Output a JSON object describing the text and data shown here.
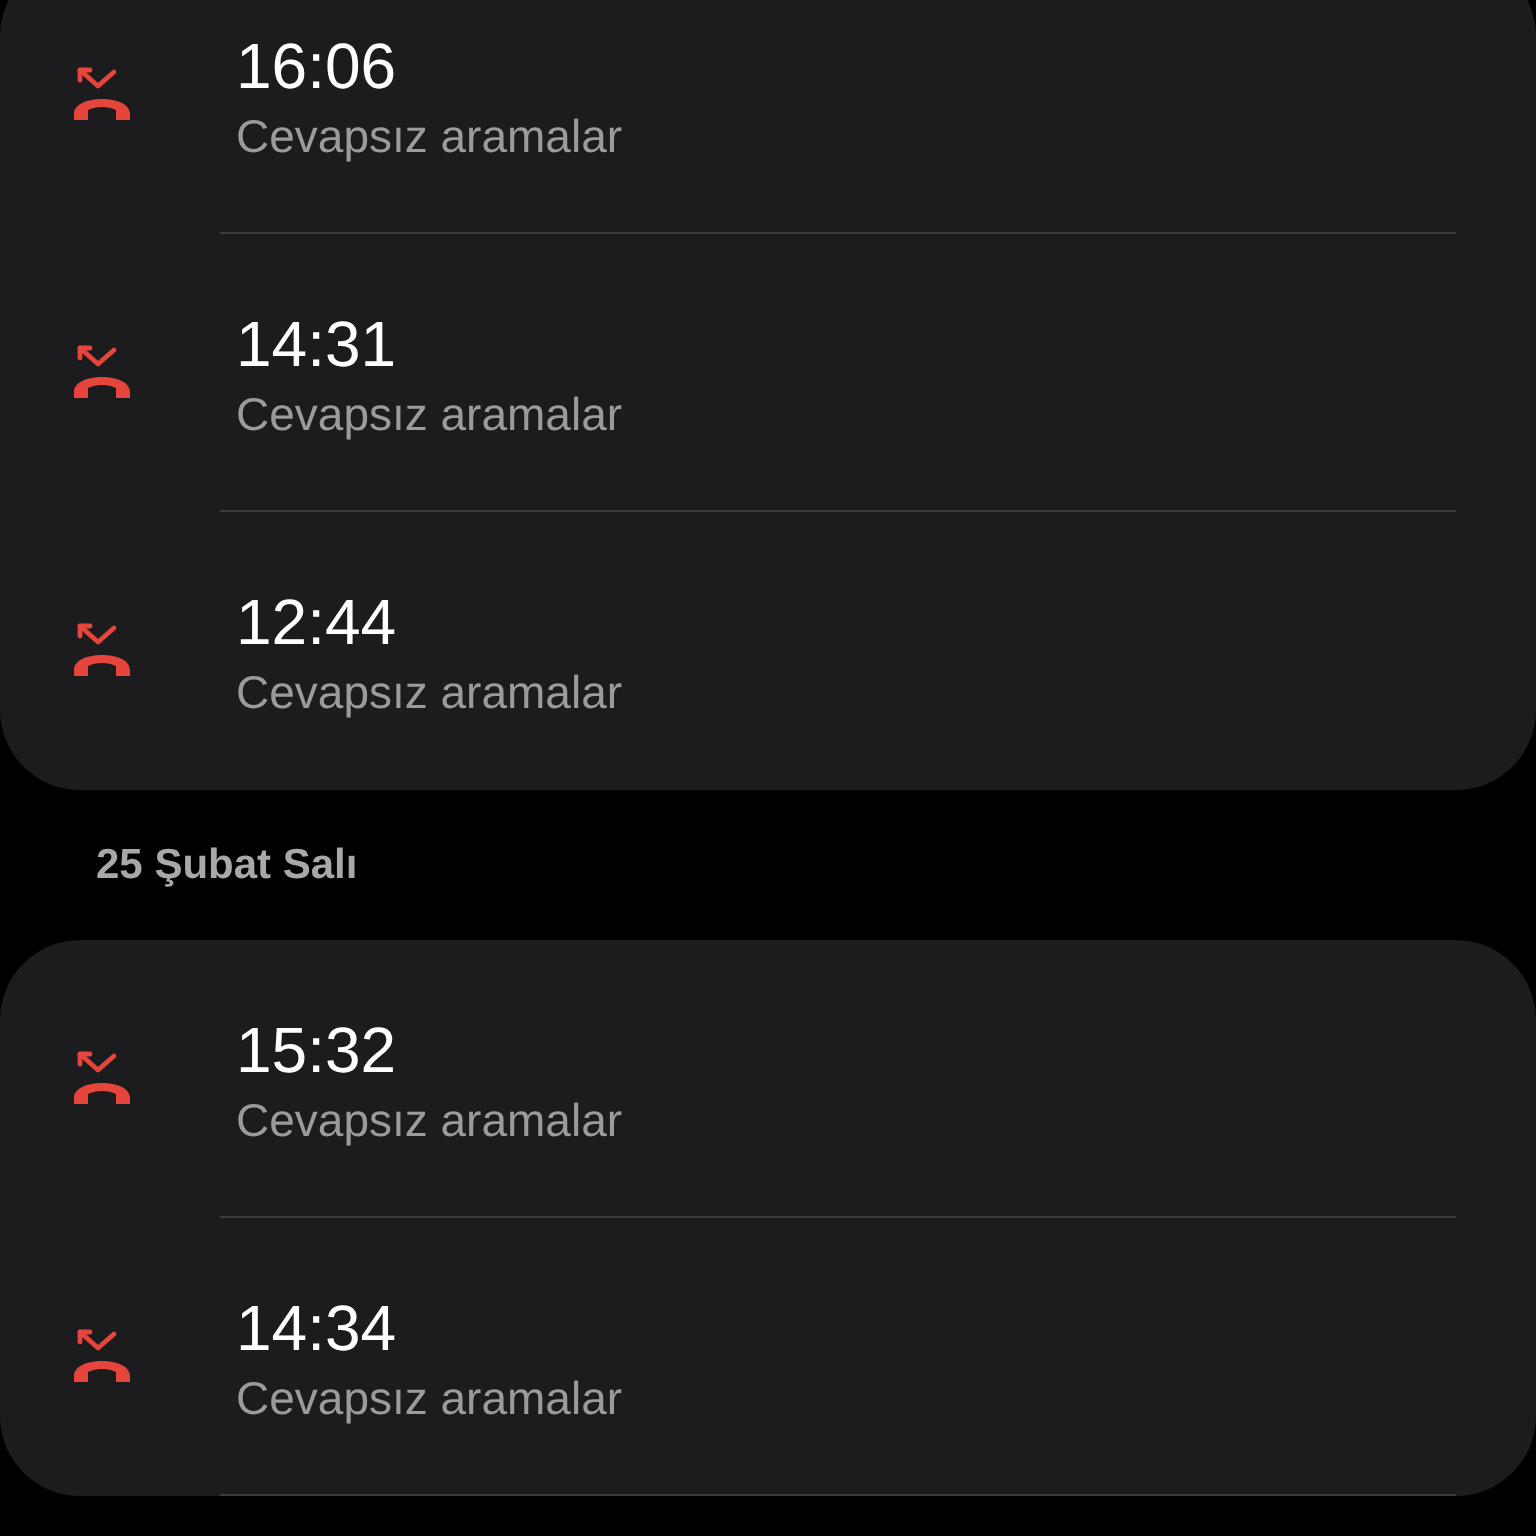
{
  "groups": [
    {
      "calls": [
        {
          "time": "16:06",
          "label": "Cevapsız aramalar"
        },
        {
          "time": "14:31",
          "label": "Cevapsız aramalar"
        },
        {
          "time": "12:44",
          "label": "Cevapsız aramalar"
        }
      ]
    },
    {
      "header": "25 Şubat Salı",
      "calls": [
        {
          "time": "15:32",
          "label": "Cevapsız aramalar"
        },
        {
          "time": "14:34",
          "label": "Cevapsız aramalar"
        }
      ]
    }
  ]
}
